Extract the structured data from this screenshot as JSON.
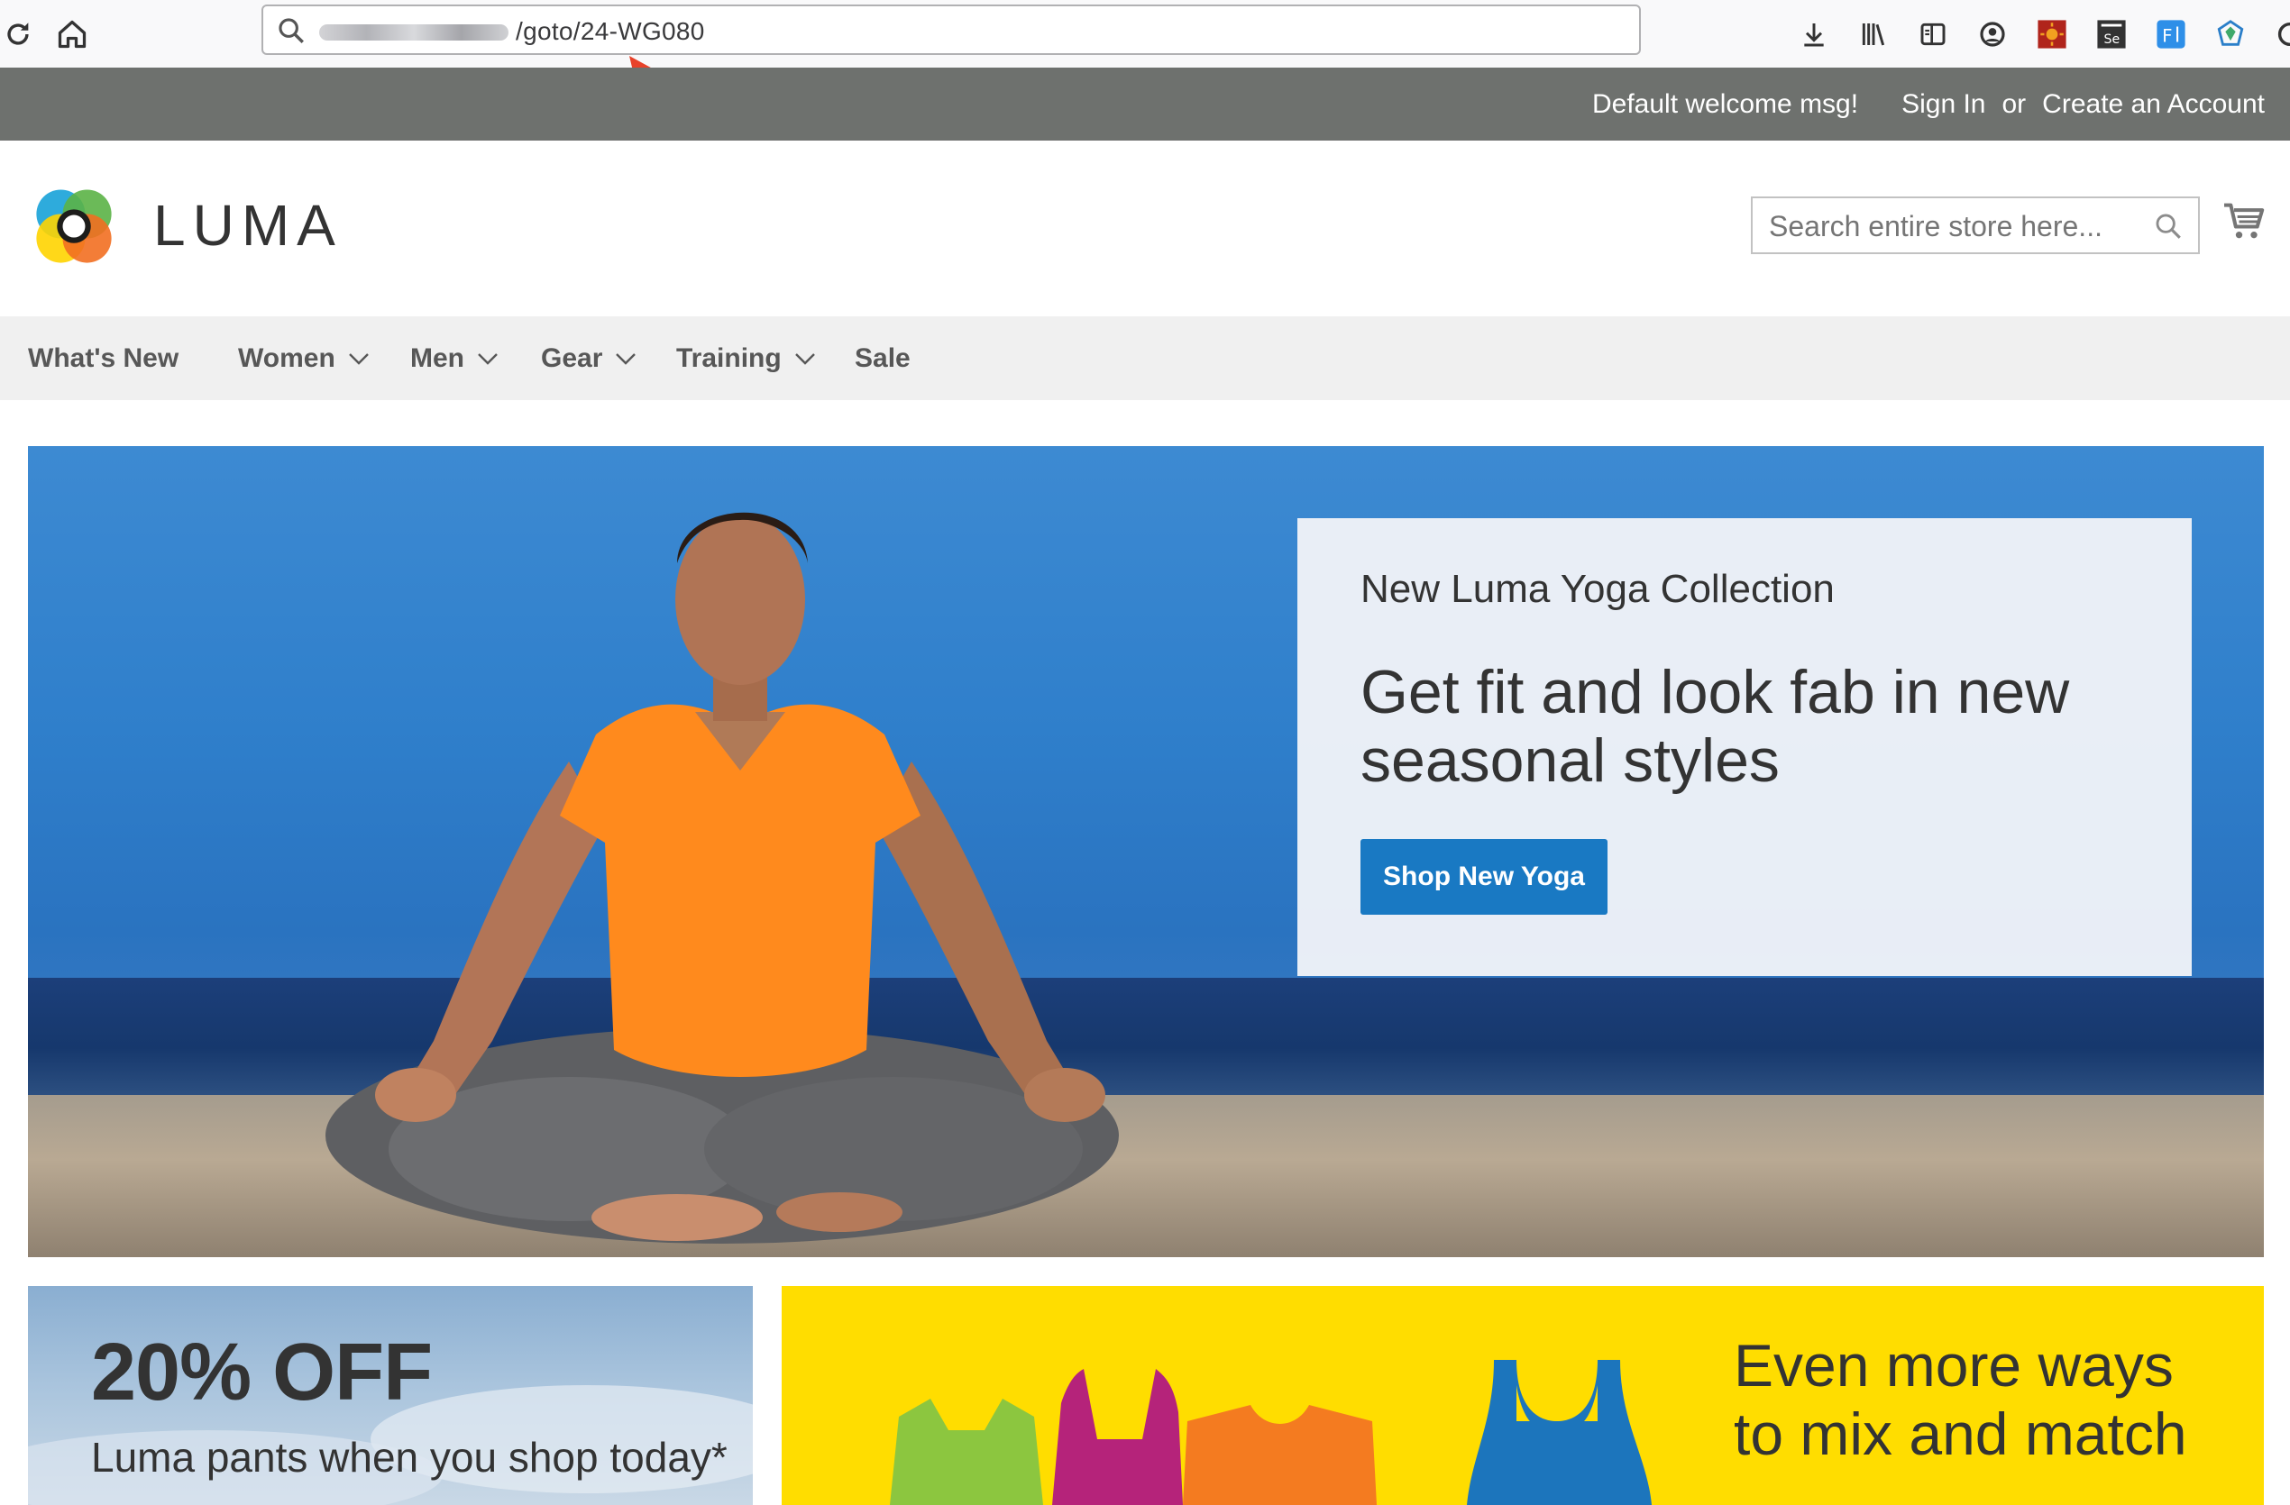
{
  "browser": {
    "url_visible": "/goto/24-WG080",
    "toolbar_icons": [
      "download-icon",
      "library-icon",
      "reader-view-icon",
      "account-icon",
      "extension-sun-icon",
      "selenium-ide-icon",
      "extension-f-icon",
      "extension-shape-icon"
    ]
  },
  "header": {
    "welcome": "Default welcome msg!",
    "sign_in": "Sign In",
    "or": "or",
    "create_account": "Create an Account"
  },
  "store": {
    "logo_text": "LUMA",
    "search_placeholder": "Search entire store here..."
  },
  "nav": {
    "items": [
      {
        "label": "What's New",
        "dropdown": false
      },
      {
        "label": "Women",
        "dropdown": true
      },
      {
        "label": "Men",
        "dropdown": true
      },
      {
        "label": "Gear",
        "dropdown": true
      },
      {
        "label": "Training",
        "dropdown": true
      },
      {
        "label": "Sale",
        "dropdown": false
      }
    ]
  },
  "hero": {
    "subtitle": "New Luma Yoga Collection",
    "title": "Get fit and look fab in new seasonal styles",
    "button": "Shop New Yoga"
  },
  "tiles": {
    "left_big": "20% OFF",
    "left_small": "Luma pants when you shop today*",
    "right_headline": "Even more ways to mix and match"
  },
  "colors": {
    "panel_header": "#6e716e",
    "nav_bg": "#f0f0f0",
    "primary_button": "#1979c3",
    "tile_yellow": "#ffdd00",
    "annotation_arrow": "#e8422a"
  }
}
